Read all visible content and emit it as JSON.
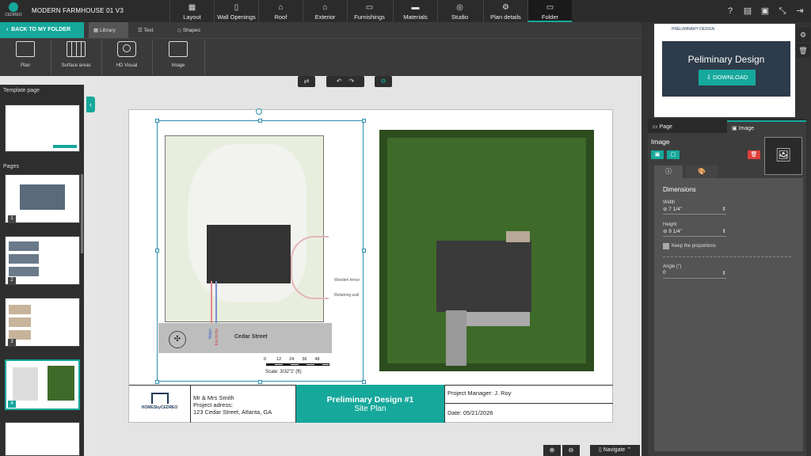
{
  "app": {
    "logo_text": "CEDREO",
    "project_title": "MODERN FARMHOUSE 01 V3"
  },
  "nav": {
    "tabs": [
      {
        "label": "Layout",
        "icon": "layout-icon"
      },
      {
        "label": "Wall Openings",
        "icon": "door-icon"
      },
      {
        "label": "Roof",
        "icon": "roof-icon"
      },
      {
        "label": "Exterior",
        "icon": "house-icon"
      },
      {
        "label": "Furnishings",
        "icon": "sofa-icon"
      },
      {
        "label": "Materials",
        "icon": "paint-roller-icon"
      },
      {
        "label": "Studio",
        "icon": "aperture-icon"
      },
      {
        "label": "Plan details",
        "icon": "plan-details-icon"
      },
      {
        "label": "Folder",
        "icon": "folder-icon"
      }
    ],
    "active": "Folder"
  },
  "toolbar2": {
    "back": "BACK TO MY FOLDER",
    "library": "Library",
    "text": "Text",
    "shapes": "Shapes"
  },
  "tools": [
    {
      "label": "Plan"
    },
    {
      "label": "Surface areas"
    },
    {
      "label": "HD Visual"
    },
    {
      "label": "Image"
    }
  ],
  "left": {
    "template_heading": "Template page",
    "pages_heading": "Pages",
    "page_numbers": [
      "1",
      "2",
      "3",
      "4"
    ]
  },
  "page": {
    "plan_labels": {
      "street": "Cedar Street",
      "scale": "Scale: 3/32\"2' (ft)",
      "scale_ticks": [
        "0",
        "12",
        "24",
        "36",
        "48"
      ],
      "wooden_fence": "Wooden fence",
      "retaining_wall": "Retaining wall",
      "water": "Water",
      "electricity": "Electricity"
    },
    "title_block": {
      "logo_text": "HOMESbyCEDREO",
      "client": "Mr & Mrs Smith",
      "address_label": "Project adress:",
      "address": "123 Cedar Street, Atlanta, GA",
      "design_title": "Preliminary Design #1",
      "design_subtitle": "Site Plan",
      "manager": "Project Manager: J. Roy",
      "date": "Date: 05/21/2026"
    }
  },
  "preview": {
    "title": "Peliminary Design",
    "download": "DOWNLOAD",
    "header": "PRELIMINARY DESIGN"
  },
  "panel": {
    "tabs": [
      {
        "label": "Page"
      },
      {
        "label": "Image"
      }
    ],
    "section_title": "Image",
    "dimensions_title": "Dimensions",
    "width_label": "Width",
    "width_value": "7 1/4\"",
    "height_label": "Height",
    "height_value": "9 1/4\"",
    "keep_proportions": "Keep the proportions",
    "angle_label": "Angle (°)",
    "angle_value": "0"
  },
  "zoom": {
    "navigate": "Navigate"
  },
  "colors": {
    "accent": "#16a89b",
    "topbar": "#2b2b2b",
    "danger": "#e0403a"
  }
}
